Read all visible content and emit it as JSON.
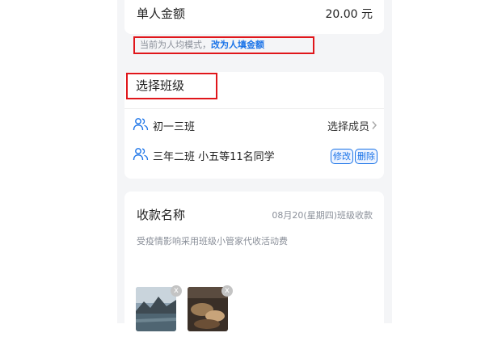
{
  "amount": {
    "label": "单人金额",
    "value": "20.00 元"
  },
  "mode_hint": {
    "text": "当前为人均模式，",
    "link": "改为人填金额"
  },
  "class_section": {
    "title": "选择班级",
    "rows": [
      {
        "name": "初一三班",
        "action": "选择成员"
      },
      {
        "name": "三年二班 小五等11名同学",
        "edit_label": "修改",
        "delete_label": "删除"
      }
    ]
  },
  "payment": {
    "name_label": "收款名称",
    "name_value": "08月20(星期四)班级收款",
    "description": "受疫情影响采用班级小管家代收活动费",
    "images": [
      {
        "remove_label": "x"
      },
      {
        "remove_label": "x"
      }
    ]
  },
  "colors": {
    "accent": "#1a73e8",
    "highlight_border": "#e0161b",
    "muted_text": "#8a8f99",
    "background": "#f4f5f7"
  },
  "icons": {
    "people": "people-icon",
    "chevron": "chevron-right-icon",
    "remove": "close-icon"
  }
}
